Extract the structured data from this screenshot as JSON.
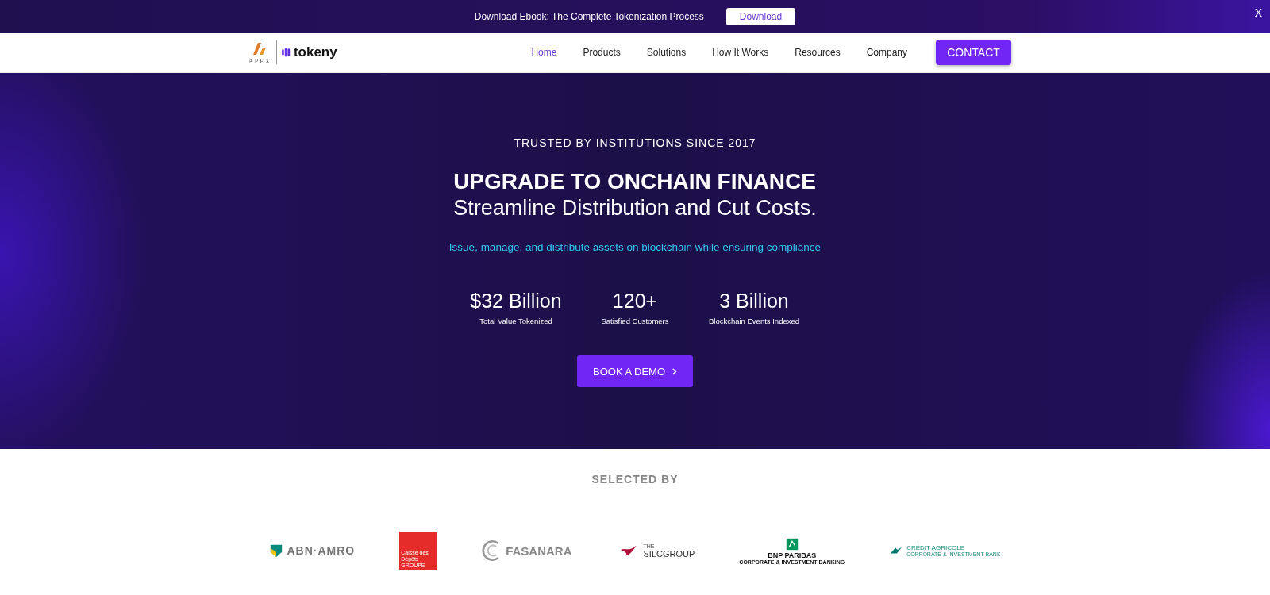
{
  "announcement": {
    "text": "Download Ebook: The Complete Tokenization Process",
    "button": "Download",
    "close": "X"
  },
  "header": {
    "logo_primary": "APEX",
    "logo_secondary": "tokeny",
    "nav": [
      {
        "label": "Home",
        "selected": true
      },
      {
        "label": "Products",
        "selected": false
      },
      {
        "label": "Solutions",
        "selected": false
      },
      {
        "label": "How It Works",
        "selected": false
      },
      {
        "label": "Resources",
        "selected": false
      },
      {
        "label": "Company",
        "selected": false
      }
    ],
    "cta": "CONTACT"
  },
  "hero": {
    "eyebrow": "TRUSTED BY INSTITUTIONS SINCE 2017",
    "title": "UPGRADE TO ONCHAIN FINANCE",
    "subtitle": "Streamline Distribution and Cut Costs.",
    "tagline": "Issue, manage, and distribute assets on blockchain while ensuring compliance",
    "stats": [
      {
        "value": "$32 Billion",
        "label": "Total Value Tokenized"
      },
      {
        "value": "120+",
        "label": "Satisfied Customers"
      },
      {
        "value": "3 Billion",
        "label": "Blockchain Events Indexed"
      }
    ],
    "button": "BOOK A DEMO"
  },
  "partners": {
    "heading": "SELECTED BY",
    "logos": [
      {
        "kind": "abn",
        "name": "ABN·AMRO"
      },
      {
        "kind": "cdc",
        "name": "Caisse des Dépôts",
        "sub": "GROUPE"
      },
      {
        "kind": "fasanara",
        "name": "FASANARA"
      },
      {
        "kind": "silc",
        "name": "SILCGROUP",
        "sub": "THE"
      },
      {
        "kind": "bnp",
        "name": "BNP PARIBAS",
        "sub": "CORPORATE & INVESTMENT BANKING"
      },
      {
        "kind": "ca",
        "name": "CRÉDIT AGRICOLE",
        "sub": "CORPORATE & INVESTMENT BANK"
      }
    ]
  }
}
